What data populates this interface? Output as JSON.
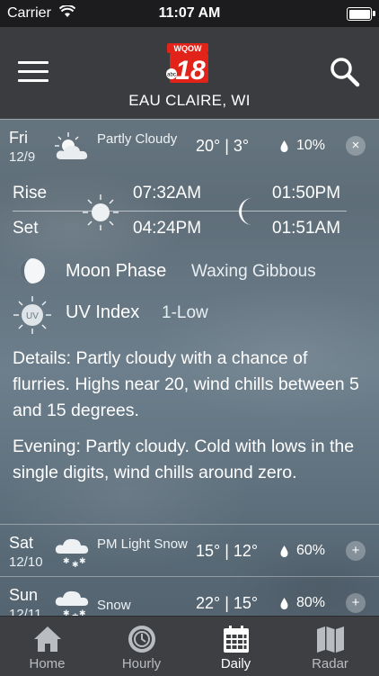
{
  "status_bar": {
    "carrier": "Carrier",
    "time": "11:07 AM"
  },
  "header": {
    "logo_text": "WQOW",
    "logo_number": "18",
    "location": "EAU CLAIRE, WI"
  },
  "days": [
    {
      "name": "Fri",
      "date": "12/9",
      "condition": "Partly Cloudy",
      "temps": "20° | 3°",
      "precip": "10%",
      "toggle": "×",
      "icon": "partly-cloudy-icon"
    },
    {
      "name": "Sat",
      "date": "12/10",
      "condition": "PM Light Snow",
      "temps": "15° | 12°",
      "precip": "60%",
      "toggle": "+",
      "icon": "snow-cloud-icon"
    },
    {
      "name": "Sun",
      "date": "12/11",
      "condition": "Snow",
      "temps": "22° | 15°",
      "precip": "80%",
      "toggle": "+",
      "icon": "snow-cloud-icon"
    }
  ],
  "expanded": {
    "rise_label": "Rise",
    "set_label": "Set",
    "sunrise": "07:32AM",
    "sunset": "04:24PM",
    "moonrise": "01:50PM",
    "moonset": "01:51AM",
    "moon_phase_label": "Moon Phase",
    "moon_phase_value": "Waxing Gibbous",
    "uv_label": "UV Index",
    "uv_value": "1-Low",
    "uv_icon_text": "UV",
    "details": "Details: Partly cloudy with a chance of flurries.  Highs near 20, wind chills between 5 and 15 degrees.",
    "evening": "Evening: Partly cloudy.  Cold with lows in the single digits, wind chills around zero."
  },
  "tabs": [
    {
      "label": "Home",
      "icon": "home-icon",
      "active": false
    },
    {
      "label": "Hourly",
      "icon": "clock-icon",
      "active": false
    },
    {
      "label": "Daily",
      "icon": "calendar-icon",
      "active": true
    },
    {
      "label": "Radar",
      "icon": "map-icon",
      "active": false
    }
  ],
  "colors": {
    "header_bg": "#3a3c40",
    "tab_bar_bg": "#3d3f43",
    "logo_red": "#e2231a"
  }
}
